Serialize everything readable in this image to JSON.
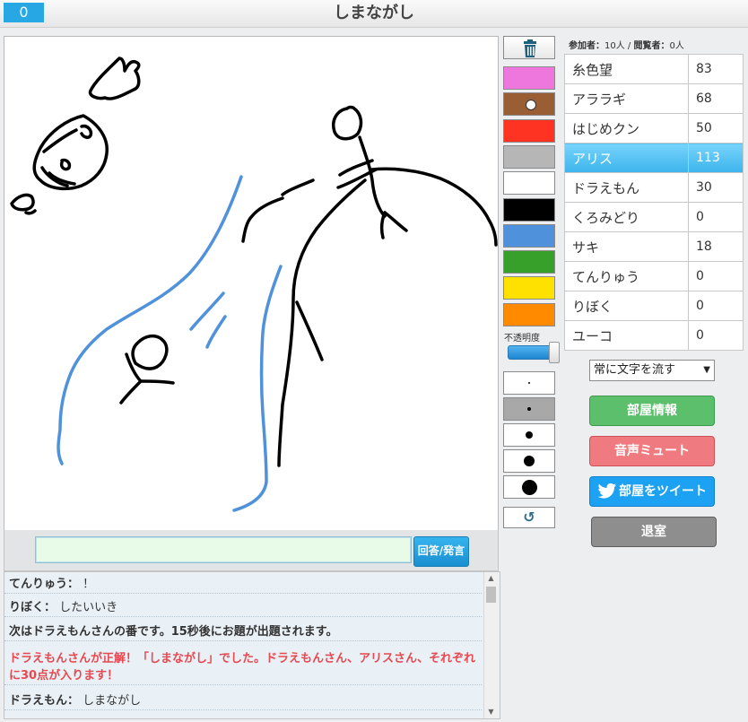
{
  "header": {
    "score": "0",
    "title": "しまながし"
  },
  "tools": {
    "colors": [
      "#ee77dd",
      "#9a5e35",
      "#ff3322",
      "#b6b6b6",
      "#ffffff",
      "#000000",
      "#4f92db",
      "#36a02b",
      "#ffe100",
      "#ff8a00"
    ],
    "selected_color_index": 1,
    "opacity_label": "不透明度",
    "opacity_value": 1.0,
    "brush_sizes": 5,
    "selected_brush_index": 1
  },
  "answer": {
    "input_value": "",
    "button_label": "回答/発言"
  },
  "chat": [
    {
      "name": "てんりゅう：",
      "text": "！"
    },
    {
      "name": "りぼく：",
      "text": "したいいき"
    },
    {
      "system": "次はドラえもんさんの番です。15秒後にお題が出題されます。"
    },
    {
      "correct": "ドラえもんさんが正解！「しまながし」でした。ドラえもんさん、アリスさん、それぞれに30点が入ります！"
    },
    {
      "name": "ドラえもん：",
      "text": "しまながし"
    }
  ],
  "participants": {
    "label1": "参加者：",
    "count1": "10人",
    "sep": "/",
    "label2": "閲覧者：",
    "count2": "0人"
  },
  "players": [
    {
      "name": "糸色望",
      "score": "83"
    },
    {
      "name": "アララギ",
      "score": "68"
    },
    {
      "name": "はじめクン",
      "score": "50"
    },
    {
      "name": "アリス",
      "score": "113",
      "active": true
    },
    {
      "name": "ドラえもん",
      "score": "30"
    },
    {
      "name": "くろみどり",
      "score": "0"
    },
    {
      "name": "サキ",
      "score": "18"
    },
    {
      "name": "てんりゅう",
      "score": "0"
    },
    {
      "name": "りぼく",
      "score": "0"
    },
    {
      "name": "ユーコ",
      "score": "0"
    }
  ],
  "text_mode": "常に文字を流す",
  "buttons": {
    "room_info": "部屋情報",
    "mute": "音声ミュート",
    "tweet": "部屋をツイート",
    "exit": "退室"
  }
}
